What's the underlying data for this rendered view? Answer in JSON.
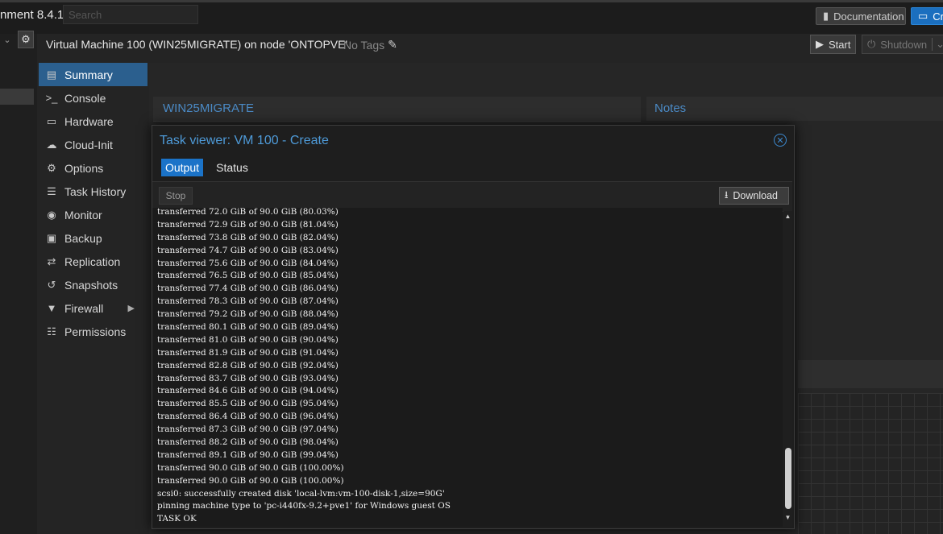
{
  "topbar": {
    "app_title": "nment 8.4.1",
    "search_placeholder": "Search",
    "documentation_label": "Documentation",
    "create_label": "Cre"
  },
  "header": {
    "vm_title": "Virtual Machine 100 (WIN25MIGRATE) on node 'ONTOPVE'",
    "tags_label": "No Tags",
    "start_label": "Start",
    "shutdown_label": "Shutdown"
  },
  "menu": {
    "items": [
      {
        "label": "Summary",
        "icon": "book-icon"
      },
      {
        "label": "Console",
        "icon": "terminal-icon"
      },
      {
        "label": "Hardware",
        "icon": "desktop-icon"
      },
      {
        "label": "Cloud-Init",
        "icon": "cloud-icon"
      },
      {
        "label": "Options",
        "icon": "gear-icon"
      },
      {
        "label": "Task History",
        "icon": "list-icon"
      },
      {
        "label": "Monitor",
        "icon": "eye-icon"
      },
      {
        "label": "Backup",
        "icon": "floppy-icon"
      },
      {
        "label": "Replication",
        "icon": "retweet-icon"
      },
      {
        "label": "Snapshots",
        "icon": "history-icon"
      },
      {
        "label": "Firewall",
        "icon": "shield-icon"
      },
      {
        "label": "Permissions",
        "icon": "unlock-icon"
      }
    ],
    "active": "Summary"
  },
  "panels": {
    "vm_name": "WIN25MIGRATE",
    "notes_title": "Notes"
  },
  "modal": {
    "title": "Task viewer: VM 100 - Create",
    "tabs": [
      "Output",
      "Status"
    ],
    "active_tab": "Output",
    "stop_label": "Stop",
    "download_label": "Download",
    "log_lines": [
      "transferred 72.0 GiB of 90.0 GiB (80.03%)",
      "transferred 72.9 GiB of 90.0 GiB (81.04%)",
      "transferred 73.8 GiB of 90.0 GiB (82.04%)",
      "transferred 74.7 GiB of 90.0 GiB (83.04%)",
      "transferred 75.6 GiB of 90.0 GiB (84.04%)",
      "transferred 76.5 GiB of 90.0 GiB (85.04%)",
      "transferred 77.4 GiB of 90.0 GiB (86.04%)",
      "transferred 78.3 GiB of 90.0 GiB (87.04%)",
      "transferred 79.2 GiB of 90.0 GiB (88.04%)",
      "transferred 80.1 GiB of 90.0 GiB (89.04%)",
      "transferred 81.0 GiB of 90.0 GiB (90.04%)",
      "transferred 81.9 GiB of 90.0 GiB (91.04%)",
      "transferred 82.8 GiB of 90.0 GiB (92.04%)",
      "transferred 83.7 GiB of 90.0 GiB (93.04%)",
      "transferred 84.6 GiB of 90.0 GiB (94.04%)",
      "transferred 85.5 GiB of 90.0 GiB (95.04%)",
      "transferred 86.4 GiB of 90.0 GiB (96.04%)",
      "transferred 87.3 GiB of 90.0 GiB (97.04%)",
      "transferred 88.2 GiB of 90.0 GiB (98.04%)",
      "transferred 89.1 GiB of 90.0 GiB (99.04%)",
      "transferred 90.0 GiB of 90.0 GiB (100.00%)",
      "transferred 90.0 GiB of 90.0 GiB (100.00%)",
      "scsi0: successfully created disk 'local-lvm:vm-100-disk-1,size=90G'",
      "pinning machine type to 'pc-i440fx-9.2+pve1' for Windows guest OS",
      "TASK OK"
    ]
  },
  "colors": {
    "accent": "#1b73c8",
    "title_blue": "#4e9ad8",
    "menu_active": "#2b5f8e"
  }
}
